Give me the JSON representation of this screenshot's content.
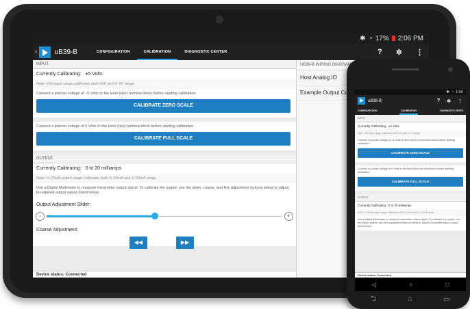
{
  "tablet": {
    "status": {
      "time": "2:06 PM",
      "battery": "17%",
      "wifi_icon": "wifi-icon",
      "bluetooth_icon": "bluetooth-icon"
    },
    "app": {
      "title": "uB39-B",
      "back_icon": "chevron-left-icon",
      "tabs": [
        {
          "label": "CONFIGURATION",
          "active": false
        },
        {
          "label": "CALIBRATION",
          "active": true
        },
        {
          "label": "DIAGNOSTIC CENTER",
          "active": false
        }
      ],
      "help_label": "?",
      "settings_icon": "gear-icon",
      "menu_label": "⋮"
    },
    "input": {
      "header": "INPUT",
      "currently_label": "Currently Calibrating:",
      "currently_value": "±5 Volts",
      "note": "Note: ±5V input range calibrates both ±5V and 0–5V range.",
      "zero_desc": "Connect a precise voltage of –5 Volts to the Host (Hxx) terminal block before starting calibration.",
      "zero_button": "CALIBRATE ZERO SCALE",
      "full_desc": "Connect a precise voltage of 5 Volts to the Host (Hxx) terminal block before starting calibration.",
      "full_button": "CALIBRATE FULL SCALE"
    },
    "output": {
      "header": "OUTPUT",
      "currently_label": "Currently Calibrating:",
      "currently_value": "0 to 20 milliamps",
      "note": "Note: 0–20mA output range calibrates both 0–20mA and 4–20mA range.",
      "desc": "Use a Digital Multimeter to measure transmitter output signal. To calibrate the output, use the slider, coarse, and fine adjustment buttons below to adjust to required output values listed below.",
      "slider_label": "Output Adjustment Slider:",
      "slider_minus": "−",
      "slider_plus": "+",
      "slider_value": 0.46,
      "coarse_label": "Coarse Adjustment:",
      "rewind_symbol": "◀◀",
      "forward_symbol": "▶▶"
    },
    "device_status": "Device status: Connected",
    "wiring": {
      "header": "UB39-B WIRING DIAGRAMS",
      "items": [
        "Host Analog IO",
        "Example Output Conn"
      ]
    }
  },
  "phone": {
    "status": {
      "time": "1:50"
    },
    "app": {
      "title": "uB39-B",
      "tabs": [
        {
          "label": "CONFIGURATION",
          "active": false
        },
        {
          "label": "CALIBRATION",
          "active": true
        },
        {
          "label": "DIAGNOSTIC CENTE",
          "active": false
        }
      ],
      "help_label": "?",
      "settings_icon": "gear-icon",
      "menu_label": "⋮"
    },
    "input": {
      "header": "INPUT",
      "currently_label": "Currently Calibrating:",
      "currently_value": "±5 Volts",
      "note": "Note: ±5V input range calibrates both ±5V and 0–5V range.",
      "zero_desc": "Connect a precise voltage of –5 Volts to the Host (Hxx) terminal block before starting calibration.",
      "zero_button": "CALIBRATE ZERO SCALE",
      "full_desc": "Connect a precise voltage of 5 Volts to the Host (Hxx) terminal block before starting calibration.",
      "full_button": "CALIBRATE FULL SCALE"
    },
    "output": {
      "header": "OUTPUT",
      "currently_label": "Currently Calibrating:",
      "currently_value": "0 to 20 milliamps",
      "note": "Note: 0–20mA output range calibrates both 0–20mA and 4–20mA range.",
      "desc": "Use a Digital Multimeter to measure transmitter output signal. To calibrate the output, use the slider, coarse, and fine adjustment buttons below to adjust to required output values listed below."
    },
    "device_status": "Device status: Connected",
    "nav": {
      "back": "◁",
      "home": "○",
      "recents": "□"
    },
    "hw_keys": {
      "back": "⮌",
      "home": "⌂",
      "recents": "▭"
    }
  },
  "colors": {
    "accent": "#29a9e5",
    "button": "#1f7fc1",
    "appbar": "#212121"
  }
}
